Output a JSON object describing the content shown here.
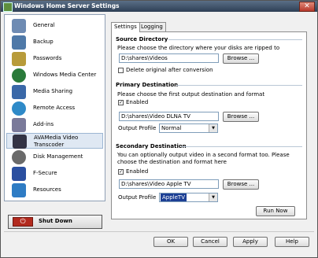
{
  "window": {
    "title": "Windows Home Server Settings",
    "close_glyph": "✕"
  },
  "sidebar": {
    "items": [
      {
        "label": "General",
        "icon": "gear-check-icon",
        "color": "#6e8bb3"
      },
      {
        "label": "Backup",
        "icon": "backup-icon",
        "color": "#4f79a8"
      },
      {
        "label": "Passwords",
        "icon": "keys-icon",
        "color": "#b89b3a"
      },
      {
        "label": "Windows Media Center",
        "icon": "media-center-icon",
        "color": "#2a7a3a"
      },
      {
        "label": "Media Sharing",
        "icon": "media-sharing-icon",
        "color": "#3a68a8"
      },
      {
        "label": "Remote Access",
        "icon": "globe-icon",
        "color": "#2e8ac8"
      },
      {
        "label": "Add-ins",
        "icon": "addin-icon",
        "color": "#7a7a9a"
      },
      {
        "label": "AVAMedia Video Transcoder",
        "icon": "transcoder-icon",
        "color": "#334"
      },
      {
        "label": "Disk Management",
        "icon": "disk-icon",
        "color": "#6a6a6a"
      },
      {
        "label": "F-Secure",
        "icon": "shield-icon",
        "color": "#2a4fa0"
      },
      {
        "label": "Resources",
        "icon": "resources-icon",
        "color": "#2e7cc4"
      }
    ],
    "shutdown_label": "Shut Down"
  },
  "tabs": [
    "Settings",
    "Logging"
  ],
  "source": {
    "title": "Source Directory",
    "desc": "Please choose the directory where your disks are ripped to",
    "path": "D:\\shares\\Videos",
    "browse": "Browse ...",
    "delete_label": "Delete original after conversion",
    "delete_checked": false
  },
  "primary": {
    "title": "Primary Destination",
    "desc": "Please choose the first output destination and format",
    "enabled_label": "Enabled",
    "enabled_checked": true,
    "path": "D:\\shares\\Video DLNA TV",
    "browse": "Browse ...",
    "profile_label": "Output Profile",
    "profile_value": "Normal"
  },
  "secondary": {
    "title": "Secondary Destination",
    "desc1": "You can optionally output video in a second format too. Please",
    "desc2": "choose the destination and format here",
    "enabled_label": "Enabled",
    "enabled_checked": true,
    "path": "D:\\shares\\Video Apple TV",
    "browse": "Browse ...",
    "profile_label": "Output Profile",
    "profile_value": "AppleTV",
    "run_now": "Run Now"
  },
  "footer": {
    "ok": "OK",
    "cancel": "Cancel",
    "apply": "Apply",
    "help": "Help"
  },
  "glyphs": {
    "check": "✓",
    "dropdown": "▼",
    "power": "⏻"
  }
}
